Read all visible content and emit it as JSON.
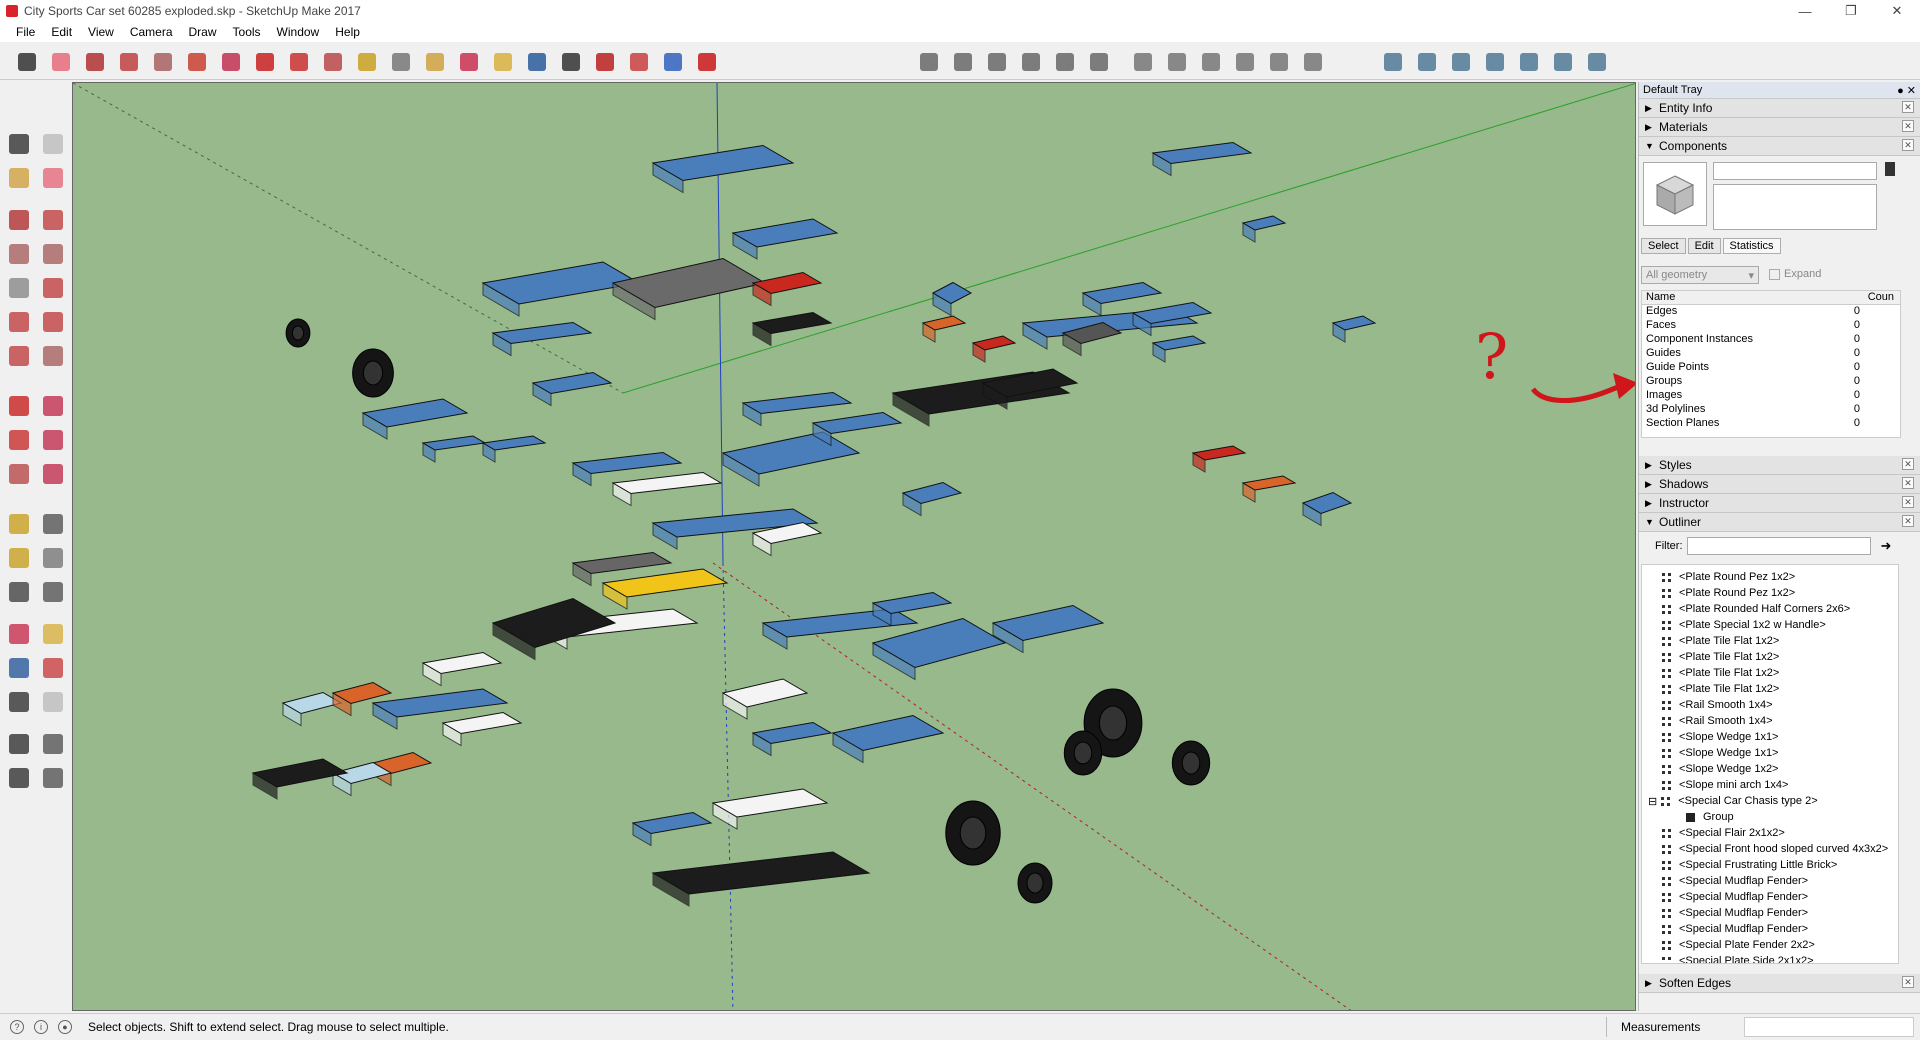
{
  "window": {
    "title": "City Sports Car set 60285 exploded.skp - SketchUp Make 2017"
  },
  "menu": [
    "File",
    "Edit",
    "View",
    "Camera",
    "Draw",
    "Tools",
    "Window",
    "Help"
  ],
  "toolbar_icons": [
    "select-icon",
    "eraser-icon",
    "pencil-icon",
    "arc-icon",
    "rectangle-icon",
    "push-pull-icon",
    "follow-me-icon",
    "move-icon",
    "rotate-icon",
    "scale-icon",
    "tape-measure-icon",
    "text-icon",
    "paint-bucket-icon",
    "orbit-icon",
    "pan-icon",
    "zoom-icon",
    "zoom-extents-icon",
    "3d-warehouse-icon",
    "extension-warehouse-icon",
    "share-model-icon",
    "ruby-icon",
    "iso-view-icon",
    "top-view-icon",
    "front-view-icon",
    "right-view-icon",
    "back-view-icon",
    "left-view-icon",
    "xray-icon",
    "wireframe-icon",
    "hidden-line-icon",
    "shaded-icon",
    "shaded-texture-icon",
    "monochrome-icon",
    "section-icon",
    "outer-shell-icon",
    "intersect-icon",
    "union-icon",
    "subtract-icon",
    "trim-icon",
    "split-icon"
  ],
  "tray": {
    "title": "Default Tray",
    "panels_top": [
      "Entity Info",
      "Materials",
      "Components"
    ],
    "components": {
      "tabs": [
        "Select",
        "Edit",
        "Statistics"
      ],
      "filter": "All geometry",
      "expand_label": "Expand",
      "col_name": "Name",
      "col_count": "Coun",
      "rows": [
        {
          "name": "Edges",
          "count": "0"
        },
        {
          "name": "Faces",
          "count": "0"
        },
        {
          "name": "Component Instances",
          "count": "0"
        },
        {
          "name": "Guides",
          "count": "0"
        },
        {
          "name": "Guide Points",
          "count": "0"
        },
        {
          "name": "Groups",
          "count": "0"
        },
        {
          "name": "Images",
          "count": "0"
        },
        {
          "name": "3d Polylines",
          "count": "0"
        },
        {
          "name": "Section Planes",
          "count": "0"
        }
      ]
    },
    "panels_bottom": [
      "Styles",
      "Shadows",
      "Instructor",
      "Outliner"
    ],
    "outliner": {
      "filter_label": "Filter:",
      "items": [
        "<Plate Round Pez 1x2>",
        "<Plate Round Pez 1x2>",
        "<Plate Rounded Half Corners 2x6>",
        "<Plate Special 1x2 w Handle>",
        "<Plate Tile Flat 1x2>",
        "<Plate Tile Flat 1x2>",
        "<Plate Tile Flat 1x2>",
        "<Plate Tile Flat 1x2>",
        "<Rail Smooth 1x4>",
        "<Rail Smooth 1x4>",
        "<Slope Wedge 1x1>",
        "<Slope Wedge 1x1>",
        "<Slope Wedge 1x2>",
        "<Slope mini arch 1x4>",
        "<Special Car Chasis type 2>",
        "Group",
        "<Special Flair 2x1x2>",
        "<Special Front hood sloped curved 4x3x2>",
        "<Special Frustrating Little Brick>",
        "<Special Mudflap Fender>",
        "<Special Mudflap Fender>",
        "<Special Mudflap Fender>",
        "<Special Mudflap Fender>",
        "<Special Plate Fender 2x2>",
        "<Special Plate Side 2x1x2>"
      ]
    },
    "soften": "Soften Edges"
  },
  "annotation": "?",
  "status": {
    "text": "Select objects. Shift to extend select. Drag mouse to select multiple.",
    "measurements": "Measurements"
  },
  "colors": {
    "viewport": "#97b98c",
    "brick_blue": "#4a7ebb",
    "brick_black": "#1c1c1c",
    "brick_white": "#f4f4f4",
    "brick_orange": "#d8642a",
    "brick_red": "#c8281e",
    "brick_yellow": "#f0c419",
    "annotation_red": "#d0151b"
  }
}
